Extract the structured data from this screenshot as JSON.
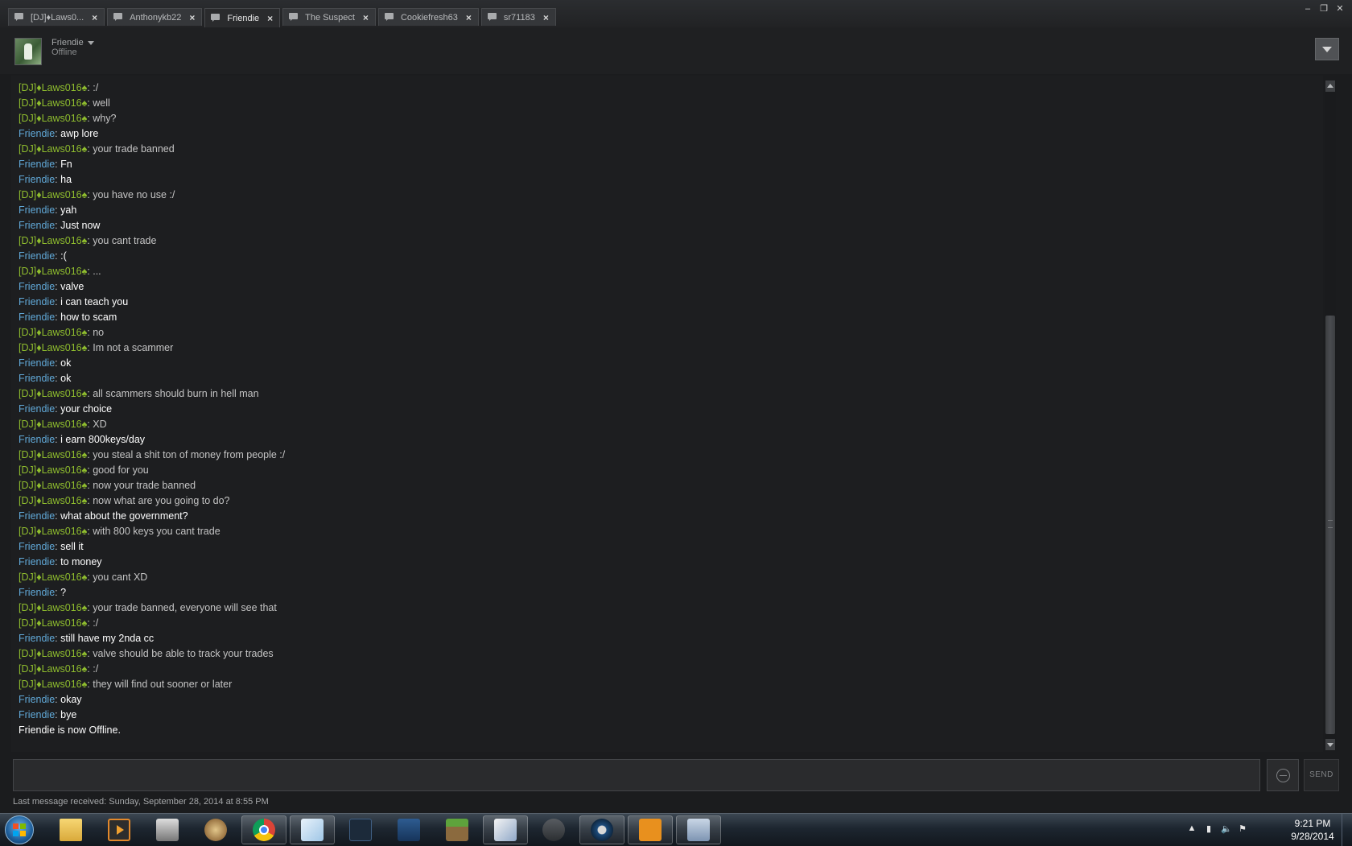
{
  "tabs": [
    {
      "label": "[DJ]♦Laws0...",
      "active": false
    },
    {
      "label": "Anthonykb22",
      "active": false
    },
    {
      "label": "Friendie",
      "active": true
    },
    {
      "label": "The Suspect",
      "active": false
    },
    {
      "label": "Cookiefresh63",
      "active": false
    },
    {
      "label": "sr71183",
      "active": false
    }
  ],
  "window_controls": {
    "minimize": "–",
    "restore": "❐",
    "close": "✕"
  },
  "header": {
    "name": "Friendie",
    "status": "Offline"
  },
  "chat": {
    "messages": [
      {
        "sender": "[DJ]♦Laws016♠",
        "text": ":/",
        "who": "me"
      },
      {
        "sender": "[DJ]♦Laws016♠",
        "text": "well",
        "who": "me"
      },
      {
        "sender": "[DJ]♦Laws016♠",
        "text": "why?",
        "who": "me"
      },
      {
        "sender": "Friendie",
        "text": "awp lore",
        "who": "them"
      },
      {
        "sender": "[DJ]♦Laws016♠",
        "text": "your trade banned",
        "who": "me"
      },
      {
        "sender": "Friendie",
        "text": "Fn",
        "who": "them"
      },
      {
        "sender": "Friendie",
        "text": "ha",
        "who": "them"
      },
      {
        "sender": "[DJ]♦Laws016♠",
        "text": "you have no use :/",
        "who": "me"
      },
      {
        "sender": "Friendie",
        "text": "yah",
        "who": "them"
      },
      {
        "sender": "Friendie",
        "text": "Just now",
        "who": "them"
      },
      {
        "sender": "[DJ]♦Laws016♠",
        "text": "you cant trade",
        "who": "me"
      },
      {
        "sender": "Friendie",
        "text": ":(",
        "who": "them"
      },
      {
        "sender": "[DJ]♦Laws016♠",
        "text": "...",
        "who": "me"
      },
      {
        "sender": "Friendie",
        "text": "valve",
        "who": "them"
      },
      {
        "sender": "Friendie",
        "text": "i can teach you",
        "who": "them"
      },
      {
        "sender": "Friendie",
        "text": "how to scam",
        "who": "them"
      },
      {
        "sender": "[DJ]♦Laws016♠",
        "text": "no",
        "who": "me"
      },
      {
        "sender": "[DJ]♦Laws016♠",
        "text": "Im not a scammer",
        "who": "me"
      },
      {
        "sender": "Friendie",
        "text": "ok",
        "who": "them"
      },
      {
        "sender": "Friendie",
        "text": "ok",
        "who": "them"
      },
      {
        "sender": "[DJ]♦Laws016♠",
        "text": "all scammers should burn in hell man",
        "who": "me"
      },
      {
        "sender": "Friendie",
        "text": "your choice",
        "who": "them"
      },
      {
        "sender": "[DJ]♦Laws016♠",
        "text": "XD",
        "who": "me"
      },
      {
        "sender": "Friendie",
        "text": "i earn 800keys/day",
        "who": "them"
      },
      {
        "sender": "[DJ]♦Laws016♠",
        "text": "you steal a shit ton of money from people :/",
        "who": "me"
      },
      {
        "sender": "[DJ]♦Laws016♠",
        "text": "good for you",
        "who": "me"
      },
      {
        "sender": "[DJ]♦Laws016♠",
        "text": "now your trade banned",
        "who": "me"
      },
      {
        "sender": "[DJ]♦Laws016♠",
        "text": "now what are you going to do?",
        "who": "me"
      },
      {
        "sender": "Friendie",
        "text": "what about the government?",
        "who": "them"
      },
      {
        "sender": "[DJ]♦Laws016♠",
        "text": "with 800 keys you cant trade",
        "who": "me"
      },
      {
        "sender": "Friendie",
        "text": "sell it",
        "who": "them"
      },
      {
        "sender": "Friendie",
        "text": "to money",
        "who": "them"
      },
      {
        "sender": "[DJ]♦Laws016♠",
        "text": "you cant XD",
        "who": "me"
      },
      {
        "sender": "Friendie",
        "text": "?",
        "who": "them"
      },
      {
        "sender": "[DJ]♦Laws016♠",
        "text": "your trade banned, everyone will see that",
        "who": "me"
      },
      {
        "sender": "[DJ]♦Laws016♠",
        "text": ":/",
        "who": "me"
      },
      {
        "sender": "Friendie",
        "text": "still have my 2nda cc",
        "who": "them"
      },
      {
        "sender": "[DJ]♦Laws016♠",
        "text": "valve should be able to track your trades",
        "who": "me"
      },
      {
        "sender": "[DJ]♦Laws016♠",
        "text": ":/",
        "who": "me"
      },
      {
        "sender": "[DJ]♦Laws016♠",
        "text": "they will find out sooner or later",
        "who": "me"
      },
      {
        "sender": "Friendie",
        "text": "okay",
        "who": "them"
      },
      {
        "sender": "Friendie",
        "text": "bye",
        "who": "them"
      }
    ],
    "system_message": "Friendie is now Offline."
  },
  "input": {
    "value": "",
    "send_label": "SEND"
  },
  "last_message": "Last message received: Sunday, September 28, 2014 at 8:55 PM",
  "colors": {
    "me": "#8fbd2e",
    "them": "#61a9d8"
  },
  "taskbar": {
    "apps": [
      {
        "name": "explorer-icon",
        "cls": "explorer"
      },
      {
        "name": "media-player-icon",
        "cls": "media"
      },
      {
        "name": "pro-app-icon",
        "cls": "pro"
      },
      {
        "name": "civ-icon",
        "cls": "civ"
      },
      {
        "name": "chrome-icon",
        "cls": "chrome"
      },
      {
        "name": "notepad-icon",
        "cls": "note"
      },
      {
        "name": "ftb-icon",
        "cls": "ftb"
      },
      {
        "name": "app-icon",
        "cls": "vs"
      },
      {
        "name": "minecraft-icon",
        "cls": "mc"
      },
      {
        "name": "paint-icon",
        "cls": "paint"
      },
      {
        "name": "movie-maker-icon",
        "cls": "film"
      },
      {
        "name": "steam-icon",
        "cls": "steam"
      },
      {
        "name": "csgo-icon",
        "cls": "csgo"
      },
      {
        "name": "calculator-icon",
        "cls": "calc"
      }
    ],
    "tray": [
      "▲",
      "▮",
      "🔈",
      "⚑"
    ],
    "clock_time": "9:21 PM",
    "clock_date": "9/28/2014"
  }
}
